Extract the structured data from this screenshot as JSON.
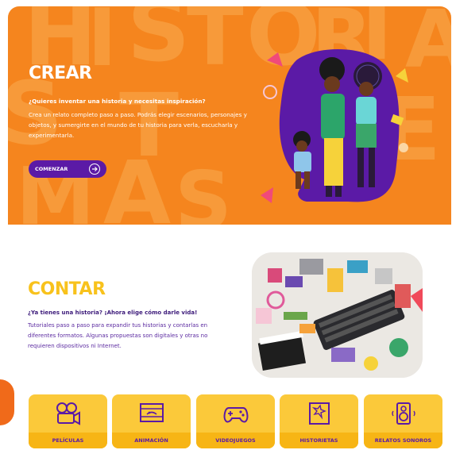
{
  "hero": {
    "title": "CREAR",
    "question": "¿Quieres inventar una historia y necesitas inspiración?",
    "description": "Crea un relato completo paso a paso. Podrás elegir escenarios, personajes y objetos, y sumergirte en el mundo de tu historia para verla, escucharla y experimentarla.",
    "button_label": "COMENZAR",
    "button_icon": "arrow-right-icon",
    "bg_letters": [
      "H",
      "I",
      "S",
      "T",
      "O",
      "R",
      "I",
      "A",
      "S",
      "T",
      "E",
      "M",
      "A",
      "S"
    ],
    "colors": {
      "background": "#f5851e",
      "button": "#5b1aa6"
    }
  },
  "contar": {
    "title": "CONTAR",
    "question": "¿Ya tienes una historia? ¡Ahora elige cómo darle vida!",
    "description": "Tutoriales paso a paso para expandir tus historias y contarlas en diferentes formatos. Algunas propuestas son digitales y otras no requieren dispositivos ni Internet.",
    "colors": {
      "title": "#f8c21c",
      "text": "#5b2aa0"
    }
  },
  "categories": [
    {
      "label": "PELÍCULAS",
      "icon": "film-camera-icon"
    },
    {
      "label": "ANIMACIÓN",
      "icon": "animation-icon"
    },
    {
      "label": "VIDEOJUEGOS",
      "icon": "gamepad-icon"
    },
    {
      "label": "HISTORIETAS",
      "icon": "comic-icon"
    },
    {
      "label": "RELATOS SONOROS",
      "icon": "speaker-icon"
    }
  ]
}
